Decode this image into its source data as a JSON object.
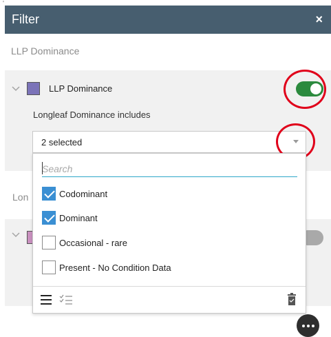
{
  "header": {
    "title": "Filter",
    "close": "×"
  },
  "groups": [
    {
      "title": "LLP Dominance"
    },
    {
      "title": "Lon"
    }
  ],
  "layer": {
    "name": "LLP Dominance",
    "expression_label": "Longleaf Dominance includes",
    "toggle_on": true
  },
  "dropdown": {
    "value": "2 selected",
    "search_placeholder": "Search",
    "options": [
      {
        "label": "Codominant",
        "checked": true
      },
      {
        "label": "Dominant",
        "checked": true
      },
      {
        "label": "Occasional - rare",
        "checked": false
      },
      {
        "label": "Present - No Condition Data",
        "checked": false
      }
    ]
  },
  "colors": {
    "header_bg": "#475e6f",
    "toggle_on": "#2b8a3e",
    "checkbox_on": "#3a8fd3",
    "swatch_1": "#7b73b8",
    "swatch_2": "#c990bf",
    "highlight": "#e0001a"
  },
  "icons": [
    "close-icon",
    "chevron-down-icon",
    "caret-down-icon",
    "list-icon",
    "checklist-icon",
    "trash-icon",
    "more-icon"
  ]
}
